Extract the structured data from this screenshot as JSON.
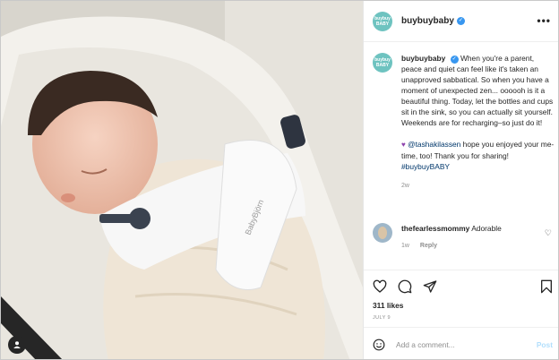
{
  "photo": {
    "alt": "baby sleeping in bouncer",
    "brand_mark": "BabyBjörn"
  },
  "header": {
    "username": "buybuybaby",
    "avatar_line1": "buybuy",
    "avatar_line2": "BABY",
    "more_icon": "more-horizontal-icon"
  },
  "caption": {
    "username": "buybuybaby",
    "text": "When you're a parent, peace and quiet can feel like it's taken an unapproved sabbatical. So when you have a moment of unexpected zen... oooooh is it a beautiful thing. Today, let the bottles and cups sit in the sink, so you can actually sit yourself. Weekends are for recharging–so just do it!",
    "mention": "@tashakilassen",
    "text2": " hope you enjoyed your me-time, too! Thank you for sharing! ",
    "hashtag": "#buybuyBABY",
    "time": "2w"
  },
  "comment": {
    "username": "thefearlessmommy",
    "text": "Adorable",
    "time": "1w",
    "reply": "Reply"
  },
  "actions": {
    "likes": "311 likes",
    "date": "JULY 9"
  },
  "add_comment": {
    "placeholder": "Add a comment...",
    "post": "Post"
  },
  "colors": {
    "brand": "#6ec3c0",
    "verified": "#3897f0",
    "link": "#00376b"
  }
}
